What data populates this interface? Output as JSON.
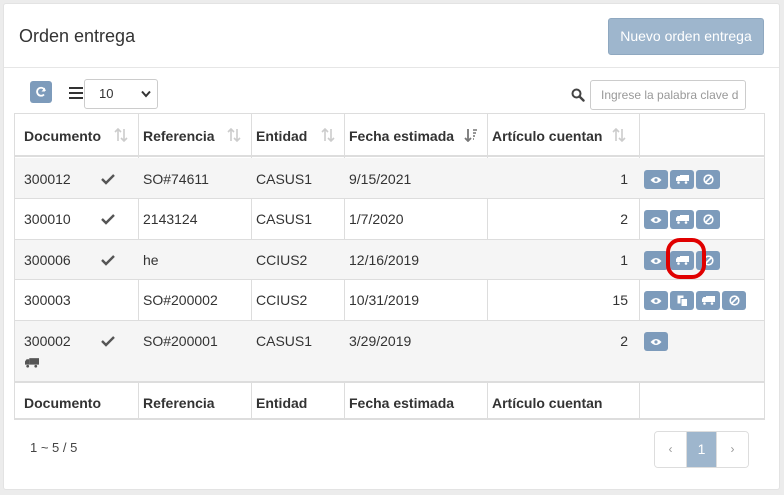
{
  "header": {
    "title": "Orden entrega",
    "new_button": "Nuevo orden entrega"
  },
  "toolbar": {
    "page_size": "10",
    "search_placeholder": "Ingrese la palabra clave d"
  },
  "table": {
    "columns": [
      "Documento",
      "Referencia",
      "Entidad",
      "Fecha estimada",
      "Artículo cuentan"
    ],
    "rows": [
      {
        "documento": "300012",
        "referencia": "SO#74611",
        "entidad": "CASUS1",
        "fecha": "9/15/2021",
        "cuentan": "1",
        "checked": true,
        "truck": false,
        "actions": [
          "view",
          "ship",
          "cancel"
        ]
      },
      {
        "documento": "300010",
        "referencia": "2143124",
        "entidad": "CASUS1",
        "fecha": "1/7/2020",
        "cuentan": "2",
        "checked": true,
        "truck": false,
        "actions": [
          "view",
          "ship",
          "cancel"
        ]
      },
      {
        "documento": "300006",
        "referencia": "he",
        "entidad": "CCIUS2",
        "fecha": "12/16/2019",
        "cuentan": "1",
        "checked": true,
        "truck": false,
        "actions": [
          "view",
          "ship",
          "cancel"
        ]
      },
      {
        "documento": "300003",
        "referencia": "SO#200002",
        "entidad": "CCIUS2",
        "fecha": "10/31/2019",
        "cuentan": "15",
        "checked": false,
        "truck": false,
        "actions": [
          "view",
          "copy",
          "ship",
          "cancel"
        ]
      },
      {
        "documento": "300002",
        "referencia": "SO#200001",
        "entidad": "CASUS1",
        "fecha": "3/29/2019",
        "cuentan": "2",
        "checked": true,
        "truck": true,
        "actions": [
          "view"
        ]
      }
    ],
    "footer": [
      "Documento",
      "Referencia",
      "Entidad",
      "Fecha estimada",
      "Artículo cuentan"
    ]
  },
  "pagination": {
    "info": "1 ~ 5 / 5",
    "prev": "‹",
    "current": "1",
    "next": "›"
  },
  "colors": {
    "accent": "#9eb6cd",
    "action_button": "#7d9bbb",
    "highlight": "#e00000"
  }
}
